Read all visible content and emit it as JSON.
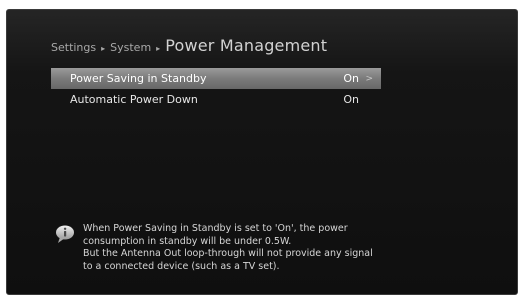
{
  "breadcrumb": {
    "item1": "Settings",
    "item2": "System",
    "separator": "▸",
    "title": "Power Management"
  },
  "menu": [
    {
      "label": "Power Saving in Standby",
      "value": "On",
      "selected": true
    },
    {
      "label": "Automatic Power Down",
      "value": "On",
      "selected": false
    }
  ],
  "help": {
    "icon": "info-speech-icon",
    "lines": [
      "When Power Saving in Standby is set to 'On', the power",
      "consumption in standby will be under 0.5W.",
      "But the Antenna Out loop-through will not provide any signal",
      "to a connected device (such as a TV set)."
    ]
  },
  "colors": {
    "background": "#111111",
    "highlight": "#808080",
    "text": "#e6e6e6"
  }
}
